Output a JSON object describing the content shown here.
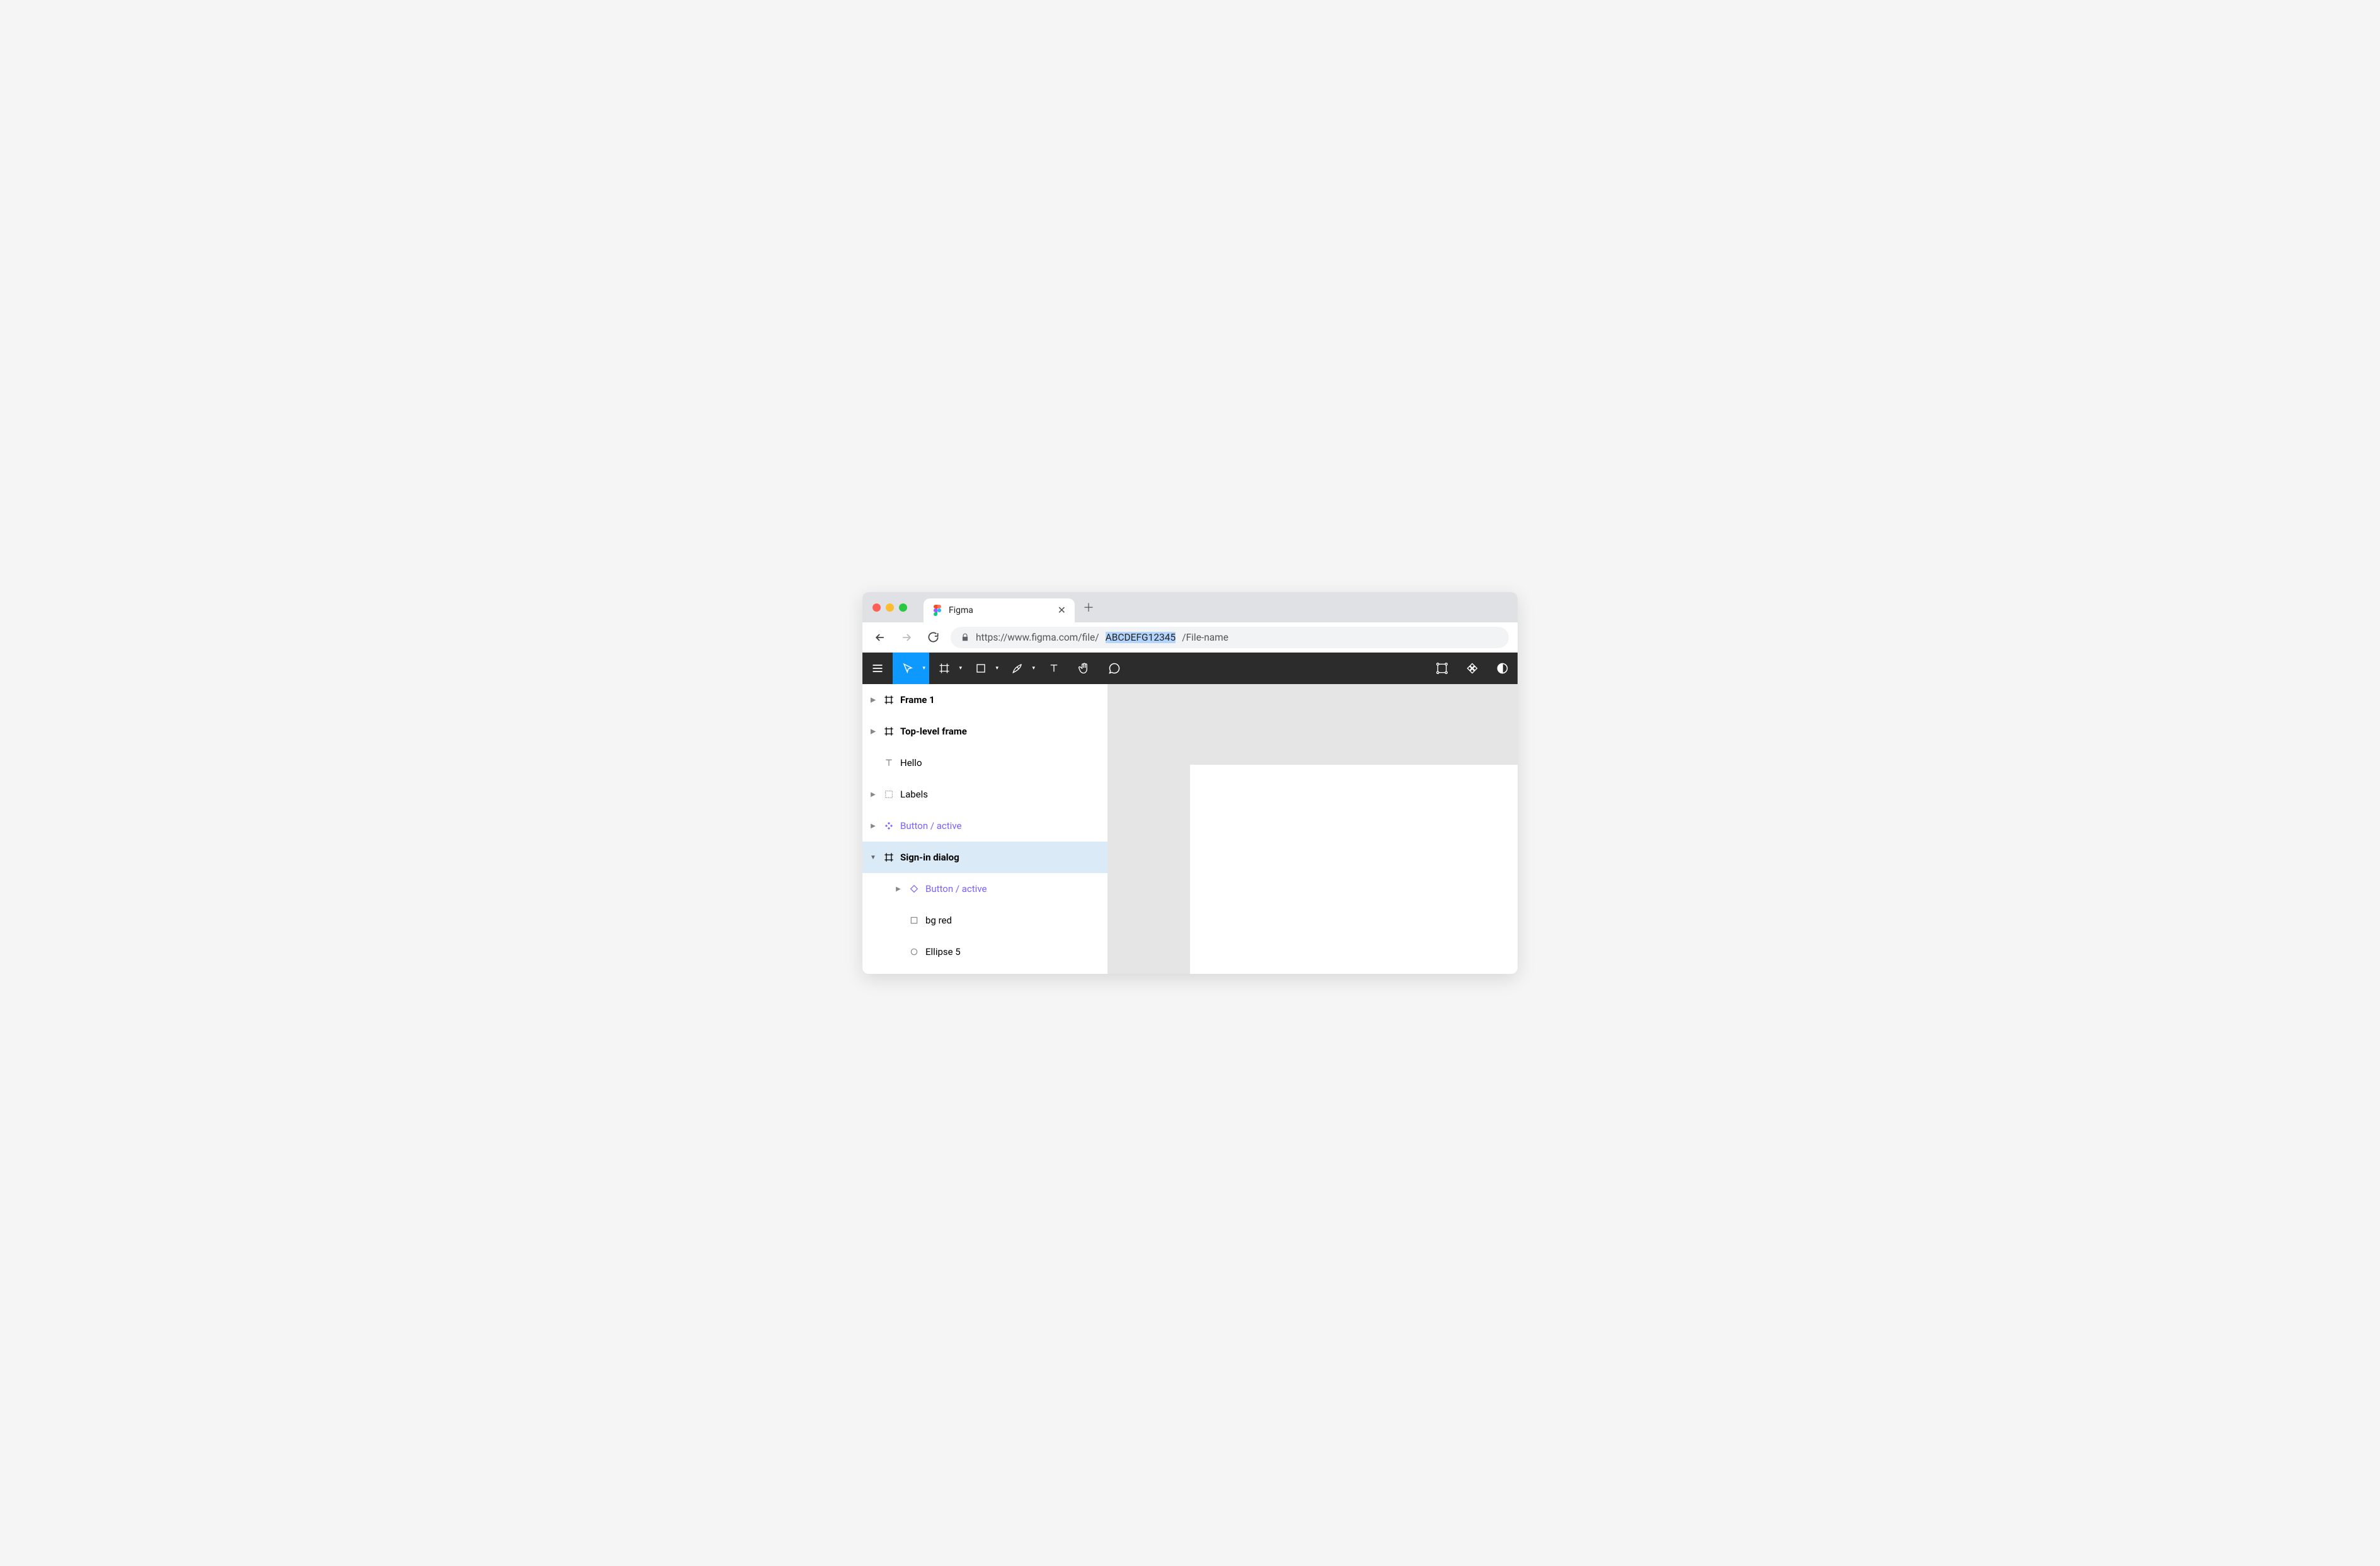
{
  "browser": {
    "tab_title": "Figma",
    "url_prefix": "https://www.figma.com/file/",
    "url_file_id": "ABCDEFG12345",
    "url_suffix": "/File-name"
  },
  "toolbar": {
    "tools": [
      "menu",
      "move",
      "frame",
      "rectangle",
      "pen",
      "text",
      "hand",
      "comment"
    ],
    "right_tools": [
      "components",
      "assets",
      "dark-mode"
    ]
  },
  "layers": [
    {
      "id": "frame1",
      "label": "Frame 1",
      "icon": "frame",
      "bold": true,
      "disclosure": "closed",
      "indent": 0
    },
    {
      "id": "toplevel",
      "label": "Top-level frame",
      "icon": "frame",
      "bold": true,
      "disclosure": "closed",
      "indent": 0
    },
    {
      "id": "hello",
      "label": "Hello",
      "icon": "text",
      "bold": false,
      "disclosure": "none",
      "indent": 0
    },
    {
      "id": "labels",
      "label": "Labels",
      "icon": "group",
      "bold": false,
      "disclosure": "closed",
      "indent": 0
    },
    {
      "id": "btn-active-1",
      "label": "Button / active",
      "icon": "component",
      "bold": false,
      "disclosure": "closed",
      "indent": 0,
      "purple": true
    },
    {
      "id": "signin",
      "label": "Sign-in dialog",
      "icon": "frame",
      "bold": true,
      "disclosure": "open",
      "indent": 0,
      "selected": true
    },
    {
      "id": "btn-active-2",
      "label": "Button / active",
      "icon": "instance",
      "bold": false,
      "disclosure": "closed",
      "indent": 1,
      "purple": true
    },
    {
      "id": "bgred",
      "label": "bg red",
      "icon": "rect",
      "bold": false,
      "disclosure": "none",
      "indent": 1
    },
    {
      "id": "ellipse5",
      "label": "Ellipse 5",
      "icon": "ellipse",
      "bold": false,
      "disclosure": "none",
      "indent": 1
    }
  ]
}
